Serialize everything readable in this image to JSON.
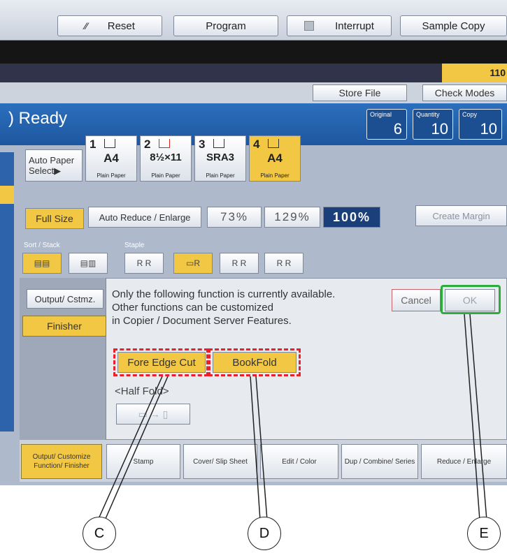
{
  "toolbar": {
    "reset": "Reset",
    "program": "Program",
    "interrupt": "Interrupt",
    "sample_copy": "Sample Copy"
  },
  "counter_partial": "110",
  "buttons": {
    "store_file": "Store File",
    "check_modes": "Check Modes"
  },
  "status": {
    "ready": "Ready",
    "original_label": "Original",
    "original_value": "6",
    "quantity_label": "Quantity",
    "quantity_value": "10",
    "copy_label": "Copy",
    "copy_value": "10"
  },
  "paper": {
    "auto_select": "Auto Paper Select▶",
    "trays": [
      {
        "num": "1",
        "size": "A4",
        "type": "Plain Paper"
      },
      {
        "num": "2",
        "size": "8½×11",
        "type": "Plain Paper"
      },
      {
        "num": "3",
        "size": "SRA3",
        "type": "Plain Paper"
      },
      {
        "num": "4",
        "size": "A4",
        "type": "Plain Paper"
      }
    ]
  },
  "zoom": {
    "full_size": "Full Size",
    "auto_reduce": "Auto Reduce / Enlarge",
    "z73": "73%",
    "z129": "129%",
    "z100": "100%",
    "create_margin": "Create Margin"
  },
  "finish": {
    "sort_stack_label": "Sort / Stack",
    "staple_label": "Staple"
  },
  "dialog": {
    "tab_output": "Output/ Cstmz.",
    "tab_finisher": "Finisher",
    "line1": "Only the following function is currently available.",
    "line2": "Other functions can be customized",
    "line3": "in Copier / Document Server Features.",
    "cancel": "Cancel",
    "ok": "OK",
    "fore_edge_cut": "Fore Edge Cut",
    "bookfold": "BookFold",
    "half_fold": "<Half Fold>"
  },
  "tabs": [
    "Output/ Customize Function/ Finisher",
    "Stamp",
    "Cover/ Slip Sheet",
    "Edit / Color",
    "Dup / Combine/ Series",
    "Reduce / Enlarge"
  ],
  "callouts": {
    "c": "C",
    "d": "D",
    "e": "E"
  },
  "colors": {
    "accent_yellow": "#f2c744",
    "status_blue": "#2b6fbd",
    "highlight_red": "#e8202a",
    "highlight_green": "#2eab3d"
  }
}
